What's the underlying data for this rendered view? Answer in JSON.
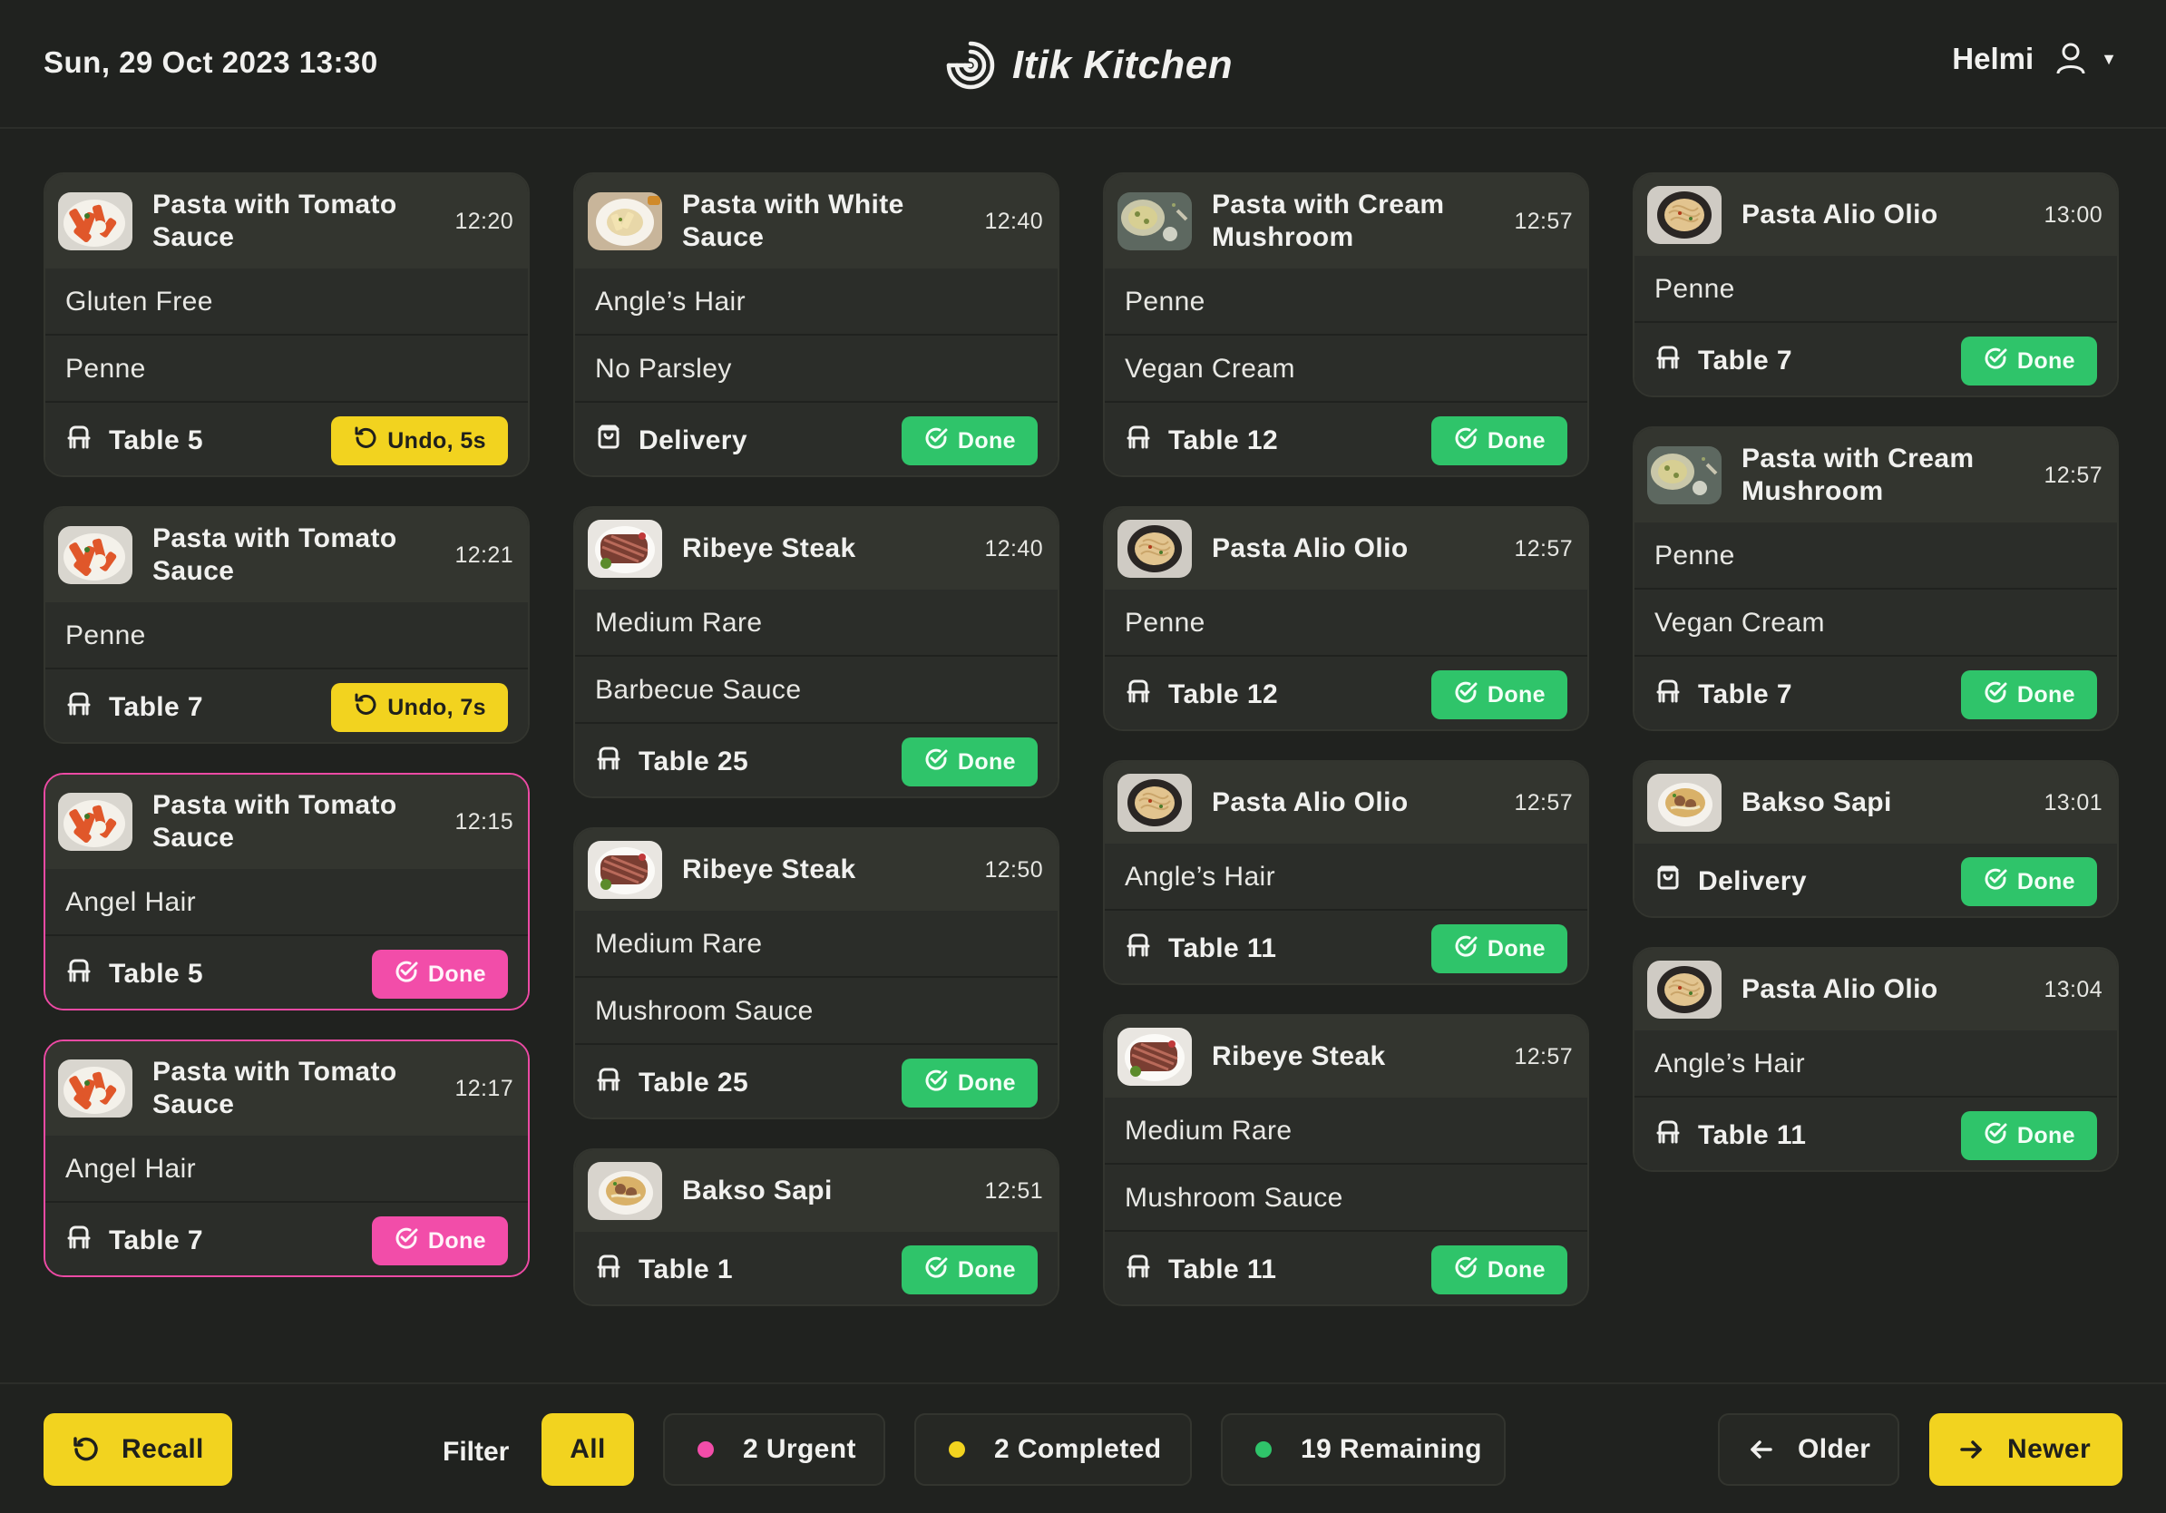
{
  "header": {
    "datetime": "Sun, 29 Oct 2023 13:30",
    "brand": "Itik Kitchen",
    "user": "Helmi"
  },
  "colors": {
    "done": "#2fc46a",
    "urgent": "#f24da9",
    "undo": "#f2d31f",
    "background": "#20221f"
  },
  "columns": [
    {
      "orders": [
        {
          "title": "Pasta with Tomato Sauce",
          "time": "12:20",
          "thumb": "tomato-pasta",
          "mods": [
            "Gluten Free",
            "Penne"
          ],
          "dest": "Table 5",
          "dest_icon": "chair-icon",
          "action": "undo",
          "action_label": "Undo, 5s",
          "urgent": false
        },
        {
          "title": "Pasta with Tomato Sauce",
          "time": "12:21",
          "thumb": "tomato-pasta",
          "mods": [
            "Penne"
          ],
          "dest": "Table 7",
          "dest_icon": "chair-icon",
          "action": "undo",
          "action_label": "Undo, 7s",
          "urgent": false
        },
        {
          "title": "Pasta with Tomato Sauce",
          "time": "12:15",
          "thumb": "tomato-pasta",
          "mods": [
            "Angel Hair"
          ],
          "dest": "Table 5",
          "dest_icon": "chair-icon",
          "action": "done",
          "action_label": "Done",
          "urgent": true
        },
        {
          "title": "Pasta with Tomato Sauce",
          "time": "12:17",
          "thumb": "tomato-pasta",
          "mods": [
            "Angel Hair"
          ],
          "dest": "Table 7",
          "dest_icon": "chair-icon",
          "action": "done",
          "action_label": "Done",
          "urgent": true
        }
      ]
    },
    {
      "orders": [
        {
          "title": "Pasta with White Sauce",
          "time": "12:40",
          "thumb": "white-pasta",
          "mods": [
            "Angle’s Hair",
            "No Parsley"
          ],
          "dest": "Delivery",
          "dest_icon": "bag-icon",
          "action": "done",
          "action_label": "Done",
          "urgent": false
        },
        {
          "title": "Ribeye Steak",
          "time": "12:40",
          "thumb": "steak",
          "mods": [
            "Medium Rare",
            "Barbecue Sauce"
          ],
          "dest": "Table 25",
          "dest_icon": "chair-icon",
          "action": "done",
          "action_label": "Done",
          "urgent": false
        },
        {
          "title": "Ribeye Steak",
          "time": "12:50",
          "thumb": "steak",
          "mods": [
            "Medium Rare",
            "Mushroom Sauce"
          ],
          "dest": "Table 25",
          "dest_icon": "chair-icon",
          "action": "done",
          "action_label": "Done",
          "urgent": false
        },
        {
          "title": "Bakso Sapi",
          "time": "12:51",
          "thumb": "bakso",
          "mods": [],
          "dest": "Table 1",
          "dest_icon": "chair-icon",
          "action": "done",
          "action_label": "Done",
          "urgent": false
        }
      ]
    },
    {
      "orders": [
        {
          "title": "Pasta with Cream Mushroom",
          "time": "12:57",
          "thumb": "cream-pasta",
          "mods": [
            "Penne",
            "Vegan Cream"
          ],
          "dest": "Table 12",
          "dest_icon": "chair-icon",
          "action": "done",
          "action_label": "Done",
          "urgent": false
        },
        {
          "title": "Pasta Alio Olio",
          "time": "12:57",
          "thumb": "alio-olio",
          "mods": [
            "Penne"
          ],
          "dest": "Table 12",
          "dest_icon": "chair-icon",
          "action": "done",
          "action_label": "Done",
          "urgent": false
        },
        {
          "title": "Pasta Alio Olio",
          "time": "12:57",
          "thumb": "alio-olio",
          "mods": [
            "Angle’s Hair"
          ],
          "dest": "Table 11",
          "dest_icon": "chair-icon",
          "action": "done",
          "action_label": "Done",
          "urgent": false
        },
        {
          "title": "Ribeye Steak",
          "time": "12:57",
          "thumb": "steak",
          "mods": [
            "Medium Rare",
            "Mushroom Sauce"
          ],
          "dest": "Table 11",
          "dest_icon": "chair-icon",
          "action": "done",
          "action_label": "Done",
          "urgent": false
        }
      ]
    },
    {
      "orders": [
        {
          "title": "Pasta Alio Olio",
          "time": "13:00",
          "thumb": "alio-olio",
          "mods": [
            "Penne"
          ],
          "dest": "Table 7",
          "dest_icon": "chair-icon",
          "action": "done",
          "action_label": "Done",
          "urgent": false
        },
        {
          "title": "Pasta with Cream Mushroom",
          "time": "12:57",
          "thumb": "cream-pasta",
          "mods": [
            "Penne",
            "Vegan Cream"
          ],
          "dest": "Table 7",
          "dest_icon": "chair-icon",
          "action": "done",
          "action_label": "Done",
          "urgent": false
        },
        {
          "title": "Bakso Sapi",
          "time": "13:01",
          "thumb": "bakso",
          "mods": [],
          "dest": "Delivery",
          "dest_icon": "bag-icon",
          "action": "done",
          "action_label": "Done",
          "urgent": false
        },
        {
          "title": "Pasta Alio Olio",
          "time": "13:04",
          "thumb": "alio-olio",
          "mods": [
            "Angle’s Hair"
          ],
          "dest": "Table 11",
          "dest_icon": "chair-icon",
          "action": "done",
          "action_label": "Done",
          "urgent": false
        }
      ]
    }
  ],
  "bottombar": {
    "recall_label": "Recall",
    "filter_label": "Filter",
    "filters": [
      {
        "label": "All",
        "dot": null,
        "active": true
      },
      {
        "label": "2 Urgent",
        "dot": "#f24da9",
        "active": false
      },
      {
        "label": "2 Completed",
        "dot": "#f2d31f",
        "active": false
      },
      {
        "label": "19 Remaining",
        "dot": "#2fc46a",
        "active": false
      }
    ],
    "older_label": "Older",
    "newer_label": "Newer"
  }
}
